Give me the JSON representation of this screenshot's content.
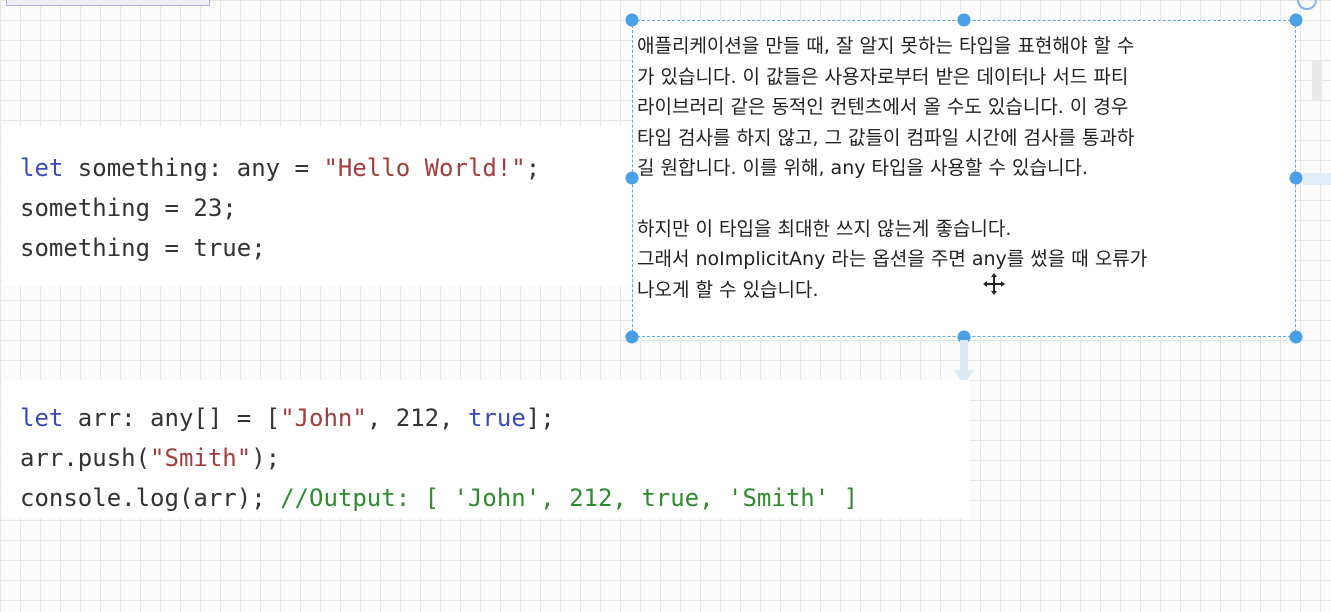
{
  "canvas": {
    "grid_color": "#e6e6e6",
    "background_color": "#fbfbfb"
  },
  "code_block_1": {
    "lines": [
      [
        {
          "text": "let",
          "kind": "kw"
        },
        {
          "text": " something: any = ",
          "kind": "plain"
        },
        {
          "text": "\"Hello World!\"",
          "kind": "str"
        },
        {
          "text": ";",
          "kind": "plain"
        }
      ],
      [
        {
          "text": "something = 23;",
          "kind": "plain"
        }
      ],
      [
        {
          "text": "something = true;",
          "kind": "plain"
        }
      ]
    ]
  },
  "code_block_2": {
    "lines": [
      [
        {
          "text": "let",
          "kind": "kw"
        },
        {
          "text": " arr: any[] = [",
          "kind": "plain"
        },
        {
          "text": "\"John\"",
          "kind": "str"
        },
        {
          "text": ", 212, ",
          "kind": "plain"
        },
        {
          "text": "true",
          "kind": "bool"
        },
        {
          "text": "];",
          "kind": "plain"
        }
      ],
      [
        {
          "text": "arr.push(",
          "kind": "plain"
        },
        {
          "text": "\"Smith\"",
          "kind": "str"
        },
        {
          "text": ");",
          "kind": "plain"
        }
      ],
      [
        {
          "text": "console.log(arr); ",
          "kind": "plain"
        },
        {
          "text": "//Output: [ 'John', 212, true, 'Smith' ]",
          "kind": "cmt"
        }
      ]
    ]
  },
  "note": {
    "paragraph_1": [
      "애플리케이션을 만들 때, 잘 알지 못하는 타입을 표현해야 할 수",
      "가 있습니다. 이 값들은 사용자로부터 받은 데이터나 서드 파티",
      "라이브러리 같은 동적인 컨텐츠에서 올 수도 있습니다. 이 경우",
      "타입 검사를 하지 않고, 그 값들이 컴파일 시간에 검사를 통과하",
      "길 원합니다. 이를 위해, any 타입을 사용할 수 있습니다."
    ],
    "paragraph_2": [
      "하지만 이 타입을 최대한 쓰지 않는게 좋습니다.",
      "그래서 noImplicitAny 라는 옵션을 주면 any를 썼을 때 오류가",
      "나오게 할 수 있습니다."
    ]
  },
  "selection": {
    "handle_color": "#4aa0e6",
    "border_color": "#5ba7e0"
  },
  "icons": {
    "move_cursor": "move-cursor-icon",
    "connector_arrow": "down-arrow-icon"
  }
}
